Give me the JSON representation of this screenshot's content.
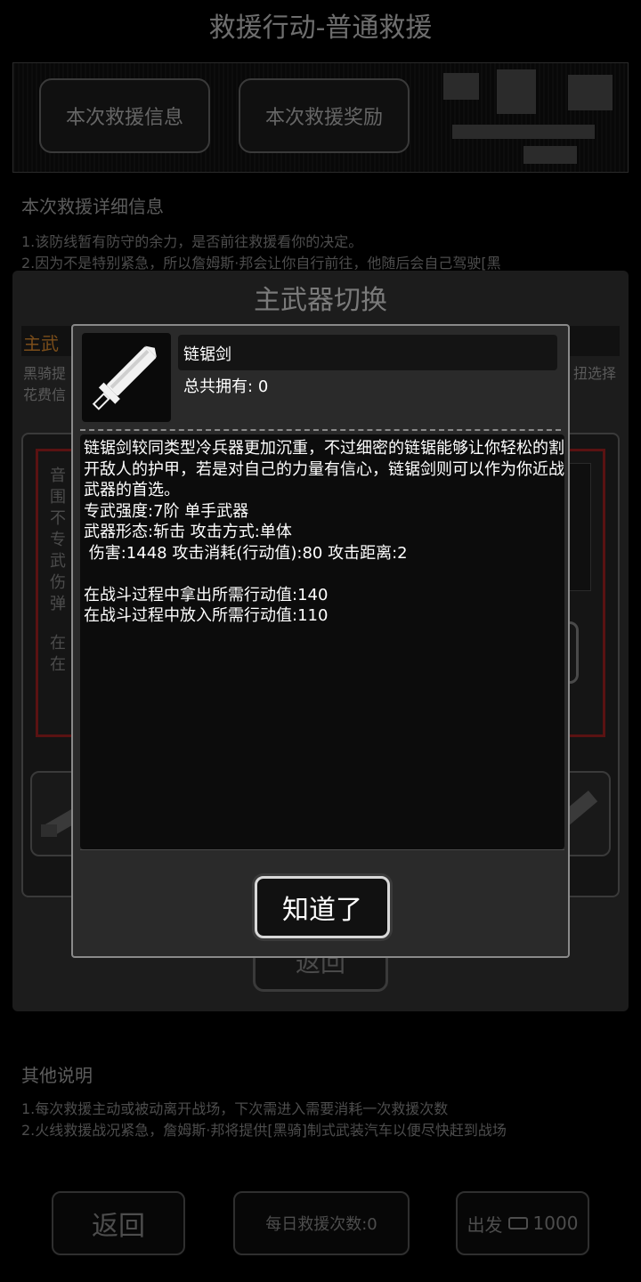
{
  "background": {
    "title": "救援行动-普通救援",
    "tabs": [
      "本次救援信息",
      "本次救援奖励"
    ],
    "detail_title": "本次救援详细信息",
    "detail_lines": [
      "1.该防线暂有防守的余力，是否前往救援看你的决定。",
      "2.因为不是特别紧急，所以詹姆斯·邦会让你自行前往，他随后会自己驾驶[黑"
    ],
    "other_title": "其他说明",
    "other_lines": [
      "1.每次救援主动或被动离开战场，下次需进入需要消耗一次救援次数",
      "2.火线救援战况紧急，詹姆斯·邦将提供[黑骑]制式武装汽车以便尽快赶到战场"
    ],
    "back_label": "返回",
    "daily_count": "每日救援次数:0",
    "depart_label": "出发",
    "depart_cost": "1000"
  },
  "weapon_switch": {
    "title": "主武器切换",
    "subtitle": "主武",
    "desc_left": [
      "黑骑提",
      "花费信"
    ],
    "desc_right": "扭选择",
    "red_lines": [
      "音",
      "围",
      "不",
      "专",
      "武",
      " 伤",
      "弹",
      "",
      "在",
      "在"
    ],
    "back_label": "返回"
  },
  "item_dialog": {
    "name": "链锯剑",
    "owned_label": "总共拥有:",
    "owned_count": "0",
    "description": "链锯剑较同类型冷兵器更加沉重，不过细密的链锯能够让你轻松的割开敌人的护甲，若是对自己的力量有信心，链锯剑则可以作为你近战武器的首选。",
    "stats": [
      "专武强度:7阶 单手武器",
      "武器形态:斩击 攻击方式:单体",
      " 伤害:1448 攻击消耗(行动值):80 攻击距离:2",
      "",
      "在战斗过程中拿出所需行动值:140",
      "在战斗过程中放入所需行动值:110"
    ],
    "ok_label": "知道了",
    "icon": "chainsaw-sword-icon"
  }
}
